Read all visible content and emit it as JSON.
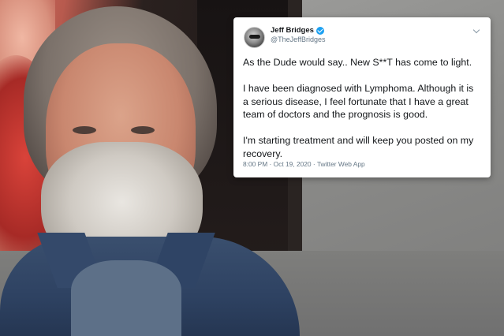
{
  "tweet": {
    "display_name": "Jeff Bridges",
    "handle": "@TheJeffBridges",
    "paragraphs": [
      "As the Dude would say.. New S**T has come to light.",
      "I have been diagnosed with Lymphoma. Although it is a serious disease, I feel fortunate that I have a great team of doctors and the prognosis is good.",
      "I'm starting treatment and will keep you posted on my recovery."
    ],
    "timestamp": "8:00 PM · Oct 19, 2020 · Twitter Web App",
    "verified_color": "#1da1f2",
    "icons": {
      "verified": "verified-badge-icon",
      "menu": "chevron-down-icon"
    }
  }
}
